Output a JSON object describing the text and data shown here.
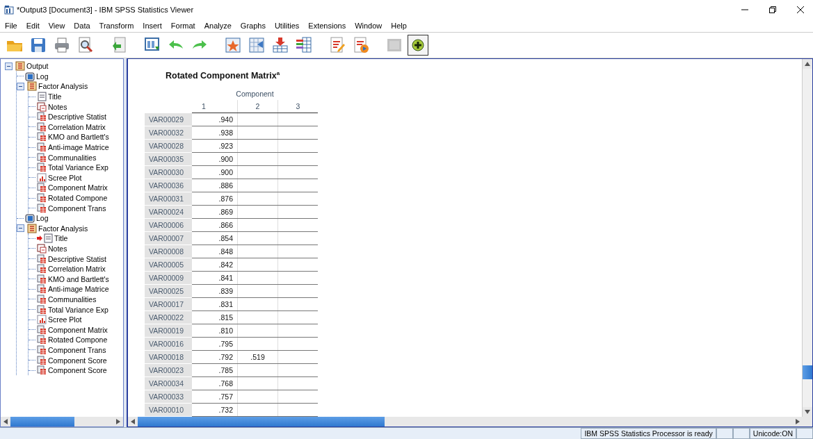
{
  "window": {
    "title": "*Output3 [Document3] - IBM SPSS Statistics Viewer"
  },
  "menu": [
    "File",
    "Edit",
    "View",
    "Data",
    "Transform",
    "Insert",
    "Format",
    "Analyze",
    "Graphs",
    "Utilities",
    "Extensions",
    "Window",
    "Help"
  ],
  "toolbar": [
    {
      "kind": "open"
    },
    {
      "kind": "save"
    },
    {
      "kind": "print"
    },
    {
      "kind": "preview"
    },
    {
      "kind": "gap"
    },
    {
      "kind": "recall"
    },
    {
      "kind": "gap"
    },
    {
      "kind": "goto-data"
    },
    {
      "kind": "undo"
    },
    {
      "kind": "redo"
    },
    {
      "kind": "gap"
    },
    {
      "kind": "star-grid"
    },
    {
      "kind": "grid-arrow"
    },
    {
      "kind": "insert-cases"
    },
    {
      "kind": "variables"
    },
    {
      "kind": "gap"
    },
    {
      "kind": "report-pencil"
    },
    {
      "kind": "report-run"
    },
    {
      "kind": "gap"
    },
    {
      "kind": "blank",
      "disabled": true
    },
    {
      "kind": "add",
      "pressed": true
    }
  ],
  "outline": [
    {
      "kind": "heading",
      "label": "Output",
      "expanded": true,
      "children": [
        {
          "kind": "log",
          "label": "Log"
        },
        {
          "kind": "heading",
          "label": "Factor Analysis",
          "expanded": true,
          "children": [
            {
              "kind": "title",
              "label": "Title",
              "current": false
            },
            {
              "kind": "notes",
              "label": "Notes",
              "current": false
            },
            {
              "kind": "table",
              "label": "Descriptive Statist",
              "current": false
            },
            {
              "kind": "table",
              "label": "Correlation Matrix",
              "current": false
            },
            {
              "kind": "table",
              "label": "KMO and Bartlett's",
              "current": false
            },
            {
              "kind": "table",
              "label": "Anti-image Matrice",
              "current": false
            },
            {
              "kind": "table",
              "label": "Communalities",
              "current": false
            },
            {
              "kind": "table",
              "label": "Total Variance Exp",
              "current": false
            },
            {
              "kind": "chart",
              "label": "Scree Plot",
              "current": false
            },
            {
              "kind": "table",
              "label": "Component Matrix",
              "current": false
            },
            {
              "kind": "table",
              "label": "Rotated Compone",
              "current": false
            },
            {
              "kind": "table",
              "label": "Component Trans",
              "current": false
            }
          ]
        },
        {
          "kind": "log",
          "label": "Log"
        },
        {
          "kind": "heading",
          "label": "Factor Analysis",
          "expanded": true,
          "children": [
            {
              "kind": "title",
              "label": "Title",
              "current": true
            },
            {
              "kind": "notes",
              "label": "Notes",
              "current": false
            },
            {
              "kind": "table",
              "label": "Descriptive Statist",
              "current": false
            },
            {
              "kind": "table",
              "label": "Correlation Matrix",
              "current": false
            },
            {
              "kind": "table",
              "label": "KMO and Bartlett's",
              "current": false
            },
            {
              "kind": "table",
              "label": "Anti-image Matrice",
              "current": false
            },
            {
              "kind": "table",
              "label": "Communalities",
              "current": false
            },
            {
              "kind": "table",
              "label": "Total Variance Exp",
              "current": false
            },
            {
              "kind": "chart",
              "label": "Scree Plot",
              "current": false
            },
            {
              "kind": "table",
              "label": "Component Matrix",
              "current": false
            },
            {
              "kind": "table",
              "label": "Rotated Compone",
              "current": false
            },
            {
              "kind": "table",
              "label": "Component Trans",
              "current": false
            },
            {
              "kind": "table",
              "label": "Component Score",
              "current": false
            },
            {
              "kind": "table",
              "label": "Component Score",
              "current": false
            }
          ]
        }
      ]
    }
  ],
  "pivot": {
    "title": "Rotated Component Matrix$^{a}$",
    "column_group": "Component",
    "columns": [
      "1",
      "2",
      "3"
    ],
    "rows": [
      {
        "label": "VAR00029",
        "values": [
          ".940"
        ]
      },
      {
        "label": "VAR00032",
        "values": [
          ".938"
        ]
      },
      {
        "label": "VAR00028",
        "values": [
          ".923"
        ]
      },
      {
        "label": "VAR00035",
        "values": [
          ".900"
        ]
      },
      {
        "label": "VAR00030",
        "values": [
          ".900"
        ]
      },
      {
        "label": "VAR00036",
        "values": [
          ".886"
        ]
      },
      {
        "label": "VAR00031",
        "values": [
          ".876"
        ]
      },
      {
        "label": "VAR00024",
        "values": [
          ".869"
        ]
      },
      {
        "label": "VAR00006",
        "values": [
          ".866"
        ]
      },
      {
        "label": "VAR00007",
        "values": [
          ".854"
        ]
      },
      {
        "label": "VAR00008",
        "values": [
          ".848"
        ]
      },
      {
        "label": "VAR00005",
        "values": [
          ".842"
        ]
      },
      {
        "label": "VAR00009",
        "values": [
          ".841"
        ]
      },
      {
        "label": "VAR00025",
        "values": [
          ".839"
        ]
      },
      {
        "label": "VAR00017",
        "values": [
          ".831"
        ]
      },
      {
        "label": "VAR00022",
        "values": [
          ".815"
        ]
      },
      {
        "label": "VAR00019",
        "values": [
          ".810"
        ]
      },
      {
        "label": "VAR00016",
        "values": [
          ".795"
        ]
      },
      {
        "label": "VAR00018",
        "values": [
          ".792",
          ".519"
        ]
      },
      {
        "label": "VAR00023",
        "values": [
          ".785"
        ]
      },
      {
        "label": "VAR00034",
        "values": [
          ".768"
        ]
      },
      {
        "label": "VAR00033",
        "values": [
          ".757"
        ]
      },
      {
        "label": "VAR00010",
        "values": [
          ".732"
        ]
      }
    ]
  },
  "status_bar": {
    "message": "IBM SPSS Statistics Processor is ready",
    "encoding": "Unicode:ON"
  }
}
